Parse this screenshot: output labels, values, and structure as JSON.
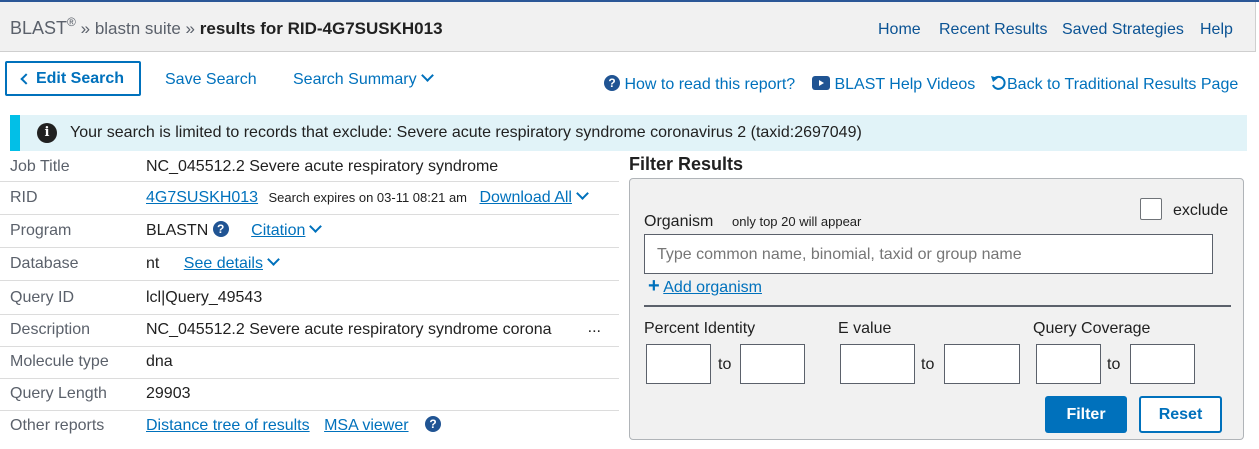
{
  "header": {
    "brand": "BLAST",
    "reg": "®",
    "sep1": "»",
    "suite": "blastn suite",
    "sep2": "»",
    "results": "results for RID-4G7SUSKH013",
    "nav": [
      "Home",
      "Recent Results",
      "Saved Strategies",
      "Help"
    ]
  },
  "toolbar": {
    "edit_search": "Edit Search",
    "save_search": "Save Search",
    "search_summary": "Search Summary",
    "how_to_read": "How to read this report?",
    "help_videos": "BLAST Help Videos",
    "back_traditional": "Back to Traditional Results Page"
  },
  "alert": {
    "text": "Your search is limited to records that exclude: Severe acute respiratory syndrome coronavirus 2 (taxid:2697049)"
  },
  "summary": {
    "job_title": {
      "label": "Job Title",
      "value": "NC_045512.2 Severe acute respiratory syndrome"
    },
    "rid": {
      "label": "RID",
      "value": "4G7SUSKH013",
      "expires": "Search expires on 03-11 08:21 am",
      "download": "Download All"
    },
    "program": {
      "label": "Program",
      "value": "BLASTN",
      "citation": "Citation"
    },
    "database": {
      "label": "Database",
      "value": "nt",
      "details": "See details"
    },
    "query_id": {
      "label": "Query ID",
      "value": "lcl|Query_49543"
    },
    "description": {
      "label": "Description",
      "value": "NC_045512.2 Severe acute respiratory syndrome corona",
      "more": "..."
    },
    "molecule": {
      "label": "Molecule type",
      "value": "dna"
    },
    "length": {
      "label": "Query Length",
      "value": "29903"
    },
    "other": {
      "label": "Other reports",
      "tree": "Distance tree of results",
      "msa": "MSA viewer"
    }
  },
  "filter": {
    "title": "Filter Results",
    "organism_label": "Organism",
    "organism_note": "only top 20 will appear",
    "exclude_label": "exclude",
    "exclude_checked": false,
    "organism_placeholder": "Type common  name, binomial, taxid or group  name",
    "add_organism": "Add organism",
    "percent_identity": "Percent Identity",
    "e_value": "E value",
    "query_coverage": "Query Coverage",
    "to": "to",
    "filter_button": "Filter",
    "reset_button": "Reset"
  },
  "colors": {
    "accent": "#0071bc",
    "alert_bg": "#e1f3f8",
    "alert_border": "#02bfe7"
  },
  "icons": [
    "info-icon",
    "question-icon",
    "video-icon",
    "back-arrow-icon",
    "plus-icon",
    "chevron-down-icon",
    "chevron-left-icon"
  ]
}
